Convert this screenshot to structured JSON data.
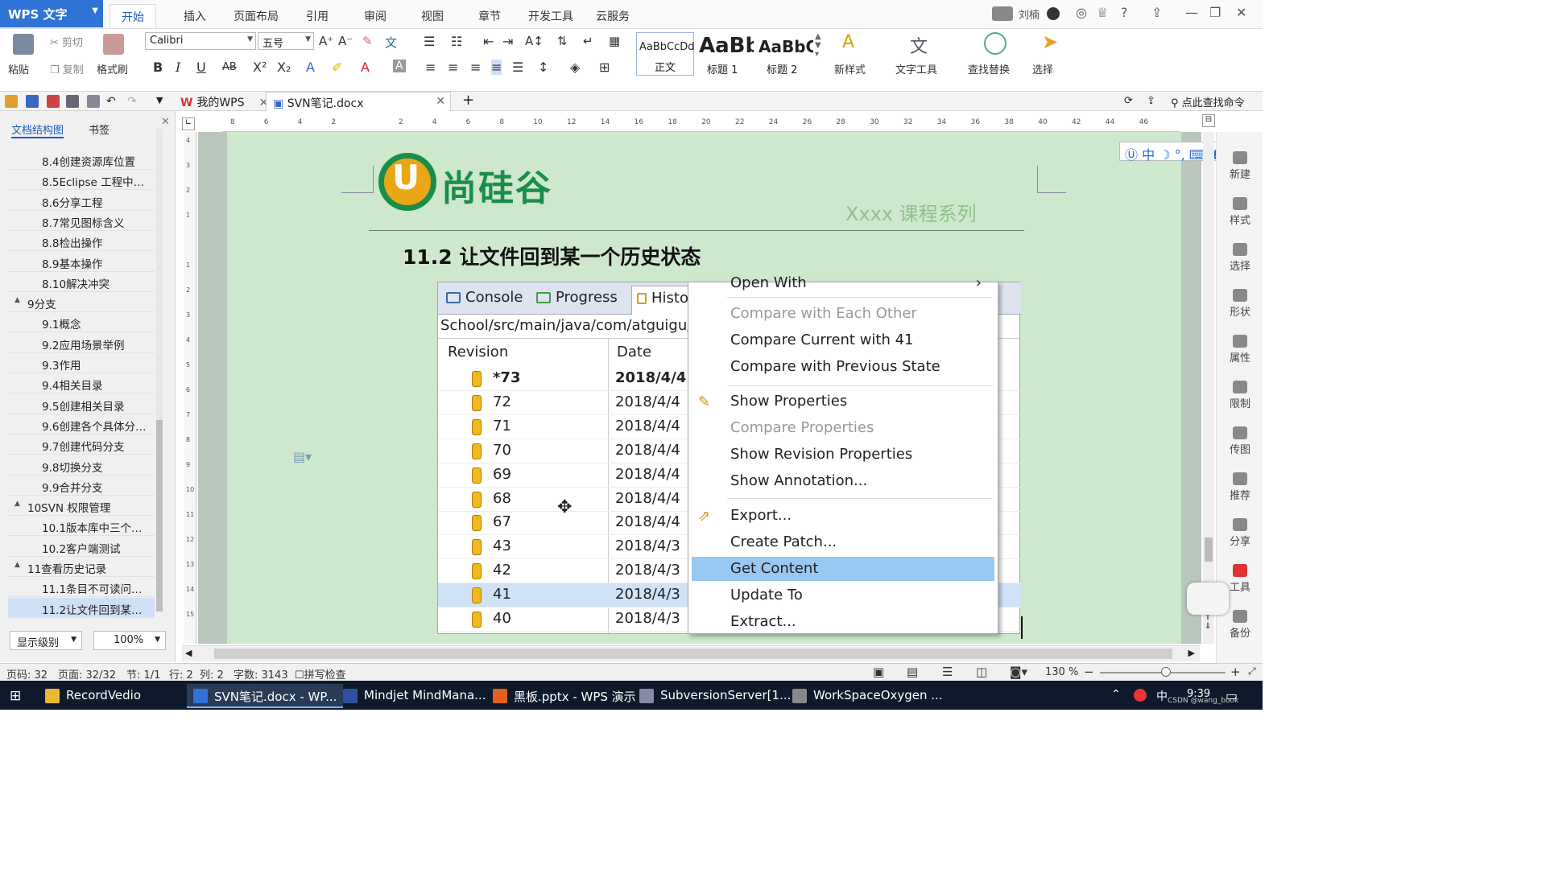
{
  "app": {
    "name": "WPS 文字",
    "user": "刘楠"
  },
  "menu_tabs": [
    "开始",
    "插入",
    "页面布局",
    "引用",
    "审阅",
    "视图",
    "章节",
    "开发工具",
    "云服务"
  ],
  "ribbon": {
    "paste": "粘贴",
    "cut": "剪切",
    "copy": "复制",
    "format_painter": "格式刷",
    "font_name": "Calibri",
    "font_size": "五号",
    "styles": [
      {
        "preview": "AaBbCcDd",
        "label": "正文"
      },
      {
        "preview": "AaBb",
        "label": "标题 1"
      },
      {
        "preview": "AaBbC",
        "label": "标题 2"
      }
    ],
    "new_style": "新样式",
    "text_tools": "文字工具",
    "find_replace": "查找替换",
    "select": "选择"
  },
  "doc_tabs": [
    {
      "label": "我的WPS"
    },
    {
      "label": "SVN笔记.docx"
    }
  ],
  "search_command": "点此查找命令",
  "left_panel": {
    "tabs": [
      "文档结构图",
      "书签"
    ],
    "tree": [
      {
        "label": "8.4创建资源库位置",
        "level": 2
      },
      {
        "label": "8.5Eclipse 工程中…",
        "level": 2
      },
      {
        "label": "8.6分享工程",
        "level": 2
      },
      {
        "label": "8.7常见图标含义",
        "level": 2
      },
      {
        "label": "8.8检出操作",
        "level": 2
      },
      {
        "label": "8.9基本操作",
        "level": 2
      },
      {
        "label": "8.10解决冲突",
        "level": 2
      },
      {
        "label": "9分支",
        "level": 1
      },
      {
        "label": "9.1概念",
        "level": 2
      },
      {
        "label": "9.2应用场景举例",
        "level": 2
      },
      {
        "label": "9.3作用",
        "level": 2
      },
      {
        "label": "9.4相关目录",
        "level": 2
      },
      {
        "label": "9.5创建相关目录",
        "level": 2
      },
      {
        "label": "9.6创建各个具体分…",
        "level": 2
      },
      {
        "label": "9.7创建代码分支",
        "level": 2
      },
      {
        "label": "9.8切换分支",
        "level": 2
      },
      {
        "label": "9.9合并分支",
        "level": 2
      },
      {
        "label": "10SVN 权限管理",
        "level": 1
      },
      {
        "label": "10.1版本库中三个…",
        "level": 2
      },
      {
        "label": "10.2客户端测试",
        "level": 2
      },
      {
        "label": "11查看历史记录",
        "level": 1
      },
      {
        "label": "11.1条目不可读问…",
        "level": 2
      },
      {
        "label": "11.2让文件回到某…",
        "level": 2,
        "selected": true
      }
    ],
    "level_btn": "显示级别",
    "zoom": "100%"
  },
  "document": {
    "logo_text": "尚硅谷",
    "series": "Xxxx 课程系列",
    "heading": "11.2 让文件回到某一个历史状态"
  },
  "eclipse": {
    "tabs": [
      "Console",
      "Progress",
      "Histo"
    ],
    "path": "School/src/main/java/com/atguigu/",
    "columns": [
      "Revision",
      "Date"
    ],
    "rows": [
      {
        "rev": "*73",
        "date": "2018/4/4",
        "bold": true
      },
      {
        "rev": "72",
        "date": "2018/4/4"
      },
      {
        "rev": "71",
        "date": "2018/4/4"
      },
      {
        "rev": "70",
        "date": "2018/4/4"
      },
      {
        "rev": "69",
        "date": "2018/4/4"
      },
      {
        "rev": "68",
        "date": "2018/4/4"
      },
      {
        "rev": "67",
        "date": "2018/4/4"
      },
      {
        "rev": "43",
        "date": "2018/4/3"
      },
      {
        "rev": "42",
        "date": "2018/4/3"
      },
      {
        "rev": "41",
        "date": "2018/4/3",
        "selected": true
      },
      {
        "rev": "40",
        "date": "2018/4/3"
      }
    ]
  },
  "context_menu": {
    "items": [
      {
        "label": "Open With",
        "disabled": false
      },
      {
        "label": "Compare with Each Other",
        "disabled": true
      },
      {
        "label": "Compare Current with 41",
        "disabled": false
      },
      {
        "label": "Compare with Previous State",
        "disabled": false
      },
      {
        "label": "Show Properties",
        "disabled": false
      },
      {
        "label": "Compare Properties",
        "disabled": true
      },
      {
        "label": "Show Revision Properties",
        "disabled": false
      },
      {
        "label": "Show Annotation...",
        "disabled": false
      },
      {
        "label": "Export...",
        "disabled": false
      },
      {
        "label": "Create Patch...",
        "disabled": false
      },
      {
        "label": "Get Content",
        "disabled": false,
        "highlighted": true
      },
      {
        "label": "Update To",
        "disabled": false
      },
      {
        "label": "Extract...",
        "disabled": false
      }
    ]
  },
  "right_bar": [
    "新建",
    "样式",
    "选择",
    "形状",
    "属性",
    "限制",
    "传图",
    "推荐",
    "分享",
    "工具",
    "备份"
  ],
  "status": {
    "page_code": "页码: 32",
    "page": "页面: 32/32",
    "section": "节: 1/1",
    "row": "行: 2",
    "col": "列: 2",
    "words": "字数: 3143",
    "spell": "拼写检查",
    "zoom": "130 %"
  },
  "taskbar": {
    "items": [
      "RecordVedio",
      "SVN笔记.docx - WP...",
      "Mindjet MindMana...",
      "黑板.pptx - WPS 演示",
      "SubversionServer[1...",
      "WorkSpaceOxygen ..."
    ],
    "ime": "中",
    "time": "9:39",
    "watermark": "CSDN @wang_book"
  },
  "colors": {
    "accent": "#2f73d6",
    "page_bg": "#cde8cd",
    "logo_green": "#1b8d4a",
    "logo_orange": "#e9a617",
    "menu_highlight": "#99c8f3"
  }
}
